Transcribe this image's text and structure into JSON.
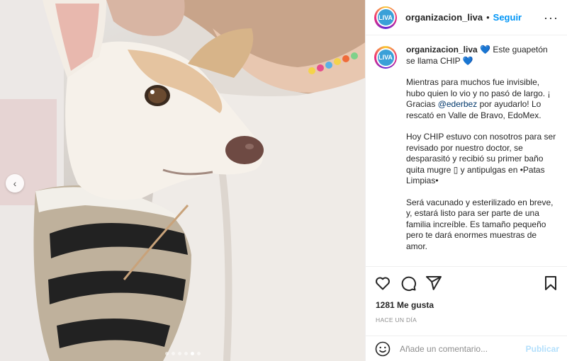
{
  "post": {
    "photo_alt": "",
    "carousel": {
      "count": 6,
      "active_index": 4
    },
    "icons": {
      "prev": "chevron-left-icon"
    }
  },
  "header": {
    "username": "organizacion_liva",
    "separator": "•",
    "follow_label": "Seguir",
    "more_icon": "more-options-icon",
    "more_glyph": "···"
  },
  "caption": {
    "username": "organizacion_liva",
    "line1": " 💙 Este guapetón se llama CHIP ",
    "heart": "💙",
    "p1_before": "Mientras para muchos fue invisible, hubo quien lo vio y no pasó de largo. ¡ Gracias ",
    "mention": "@ederbez",
    "p1_after": " por ayudarlo! Lo rescató en Valle de Bravo, EdoMex.",
    "p2": "Hoy CHIP estuvo con nosotros para ser revisado por nuestro doctor, se desparasitó y recibió su primer baño quita mugre ▯ y antipulgas en •Patas Limpias•",
    "p3": "Será vacunado y esterilizado en breve, y, estará listo para ser parte de una familia increíble. Es tamaño pequeño pero te dará enormes muestras de amor."
  },
  "actions": {
    "like_icon": "heart-icon",
    "comment_icon": "comment-icon",
    "share_icon": "share-icon",
    "save_icon": "bookmark-icon"
  },
  "stats": {
    "likes": "1281 Me gusta",
    "time": "HACE UN DÍA"
  },
  "comment": {
    "emoji_icon": "emoji-icon",
    "placeholder": "Añade un comentario...",
    "publish_label": "Publicar"
  },
  "colors": {
    "accent": "#0095f6",
    "publish_disabled": "#b2dffc",
    "mention": "#00376b",
    "secondary_text": "#8e8e8e",
    "avatar_logo": "#3aa0d8"
  }
}
